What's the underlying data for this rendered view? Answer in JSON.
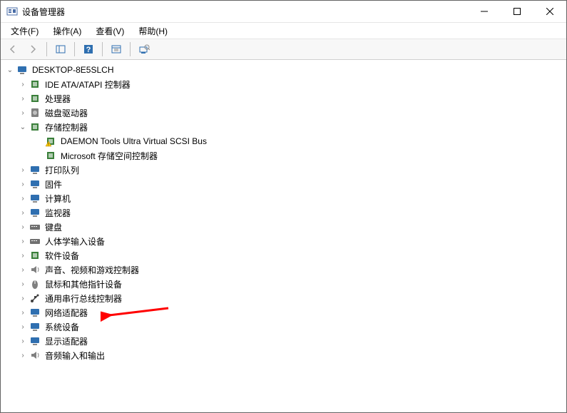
{
  "window": {
    "title": "设备管理器"
  },
  "menu": {
    "file": "文件(F)",
    "action": "操作(A)",
    "view": "查看(V)",
    "help": "帮助(H)"
  },
  "root": {
    "name": "DESKTOP-8E5SLCH"
  },
  "categories": [
    {
      "id": "ide",
      "label": "IDE ATA/ATAPI 控制器",
      "expanded": false,
      "icon": "ide"
    },
    {
      "id": "cpu",
      "label": "处理器",
      "expanded": false,
      "icon": "cpu"
    },
    {
      "id": "disk",
      "label": "磁盘驱动器",
      "expanded": false,
      "icon": "disk"
    },
    {
      "id": "storage",
      "label": "存储控制器",
      "expanded": true,
      "icon": "storage",
      "children": [
        {
          "id": "daemon",
          "label": "DAEMON Tools Ultra Virtual SCSI Bus",
          "warn": true
        },
        {
          "id": "msstor",
          "label": "Microsoft 存储空间控制器",
          "warn": false
        }
      ]
    },
    {
      "id": "printq",
      "label": "打印队列",
      "expanded": false,
      "icon": "print"
    },
    {
      "id": "firmware",
      "label": "固件",
      "expanded": false,
      "icon": "chip"
    },
    {
      "id": "computer",
      "label": "计算机",
      "expanded": false,
      "icon": "computer"
    },
    {
      "id": "monitor",
      "label": "监视器",
      "expanded": false,
      "icon": "monitor"
    },
    {
      "id": "keyboard",
      "label": "键盘",
      "expanded": false,
      "icon": "keyboard"
    },
    {
      "id": "hid",
      "label": "人体学输入设备",
      "expanded": false,
      "icon": "hid"
    },
    {
      "id": "softdev",
      "label": "软件设备",
      "expanded": false,
      "icon": "soft"
    },
    {
      "id": "sound",
      "label": "声音、视频和游戏控制器",
      "expanded": false,
      "icon": "sound"
    },
    {
      "id": "mouse",
      "label": "鼠标和其他指针设备",
      "expanded": false,
      "icon": "mouse"
    },
    {
      "id": "usb",
      "label": "通用串行总线控制器",
      "expanded": false,
      "icon": "usb"
    },
    {
      "id": "network",
      "label": "网络适配器",
      "expanded": false,
      "icon": "network",
      "highlight": true
    },
    {
      "id": "system",
      "label": "系统设备",
      "expanded": false,
      "icon": "system"
    },
    {
      "id": "display",
      "label": "显示适配器",
      "expanded": false,
      "icon": "display"
    },
    {
      "id": "audioio",
      "label": "音频输入和输出",
      "expanded": false,
      "icon": "sound"
    }
  ],
  "icons": {
    "app": "#4a6da7",
    "ide": "#3a7f3a",
    "cpu": "#3a7f3a",
    "disk": "#808080",
    "storage": "#3a7f3a",
    "print": "#2f6fb0",
    "chip": "#2f6fb0",
    "computer": "#2f6fb0",
    "monitor": "#2f6fb0",
    "keyboard": "#707070",
    "hid": "#707070",
    "soft": "#3a7f3a",
    "sound": "#808080",
    "mouse": "#808080",
    "usb": "#404040",
    "network": "#2f6fb0",
    "system": "#2f6fb0",
    "display": "#2f6fb0"
  },
  "glyphs": {
    "collapsed": "›",
    "expanded": "⌄"
  }
}
